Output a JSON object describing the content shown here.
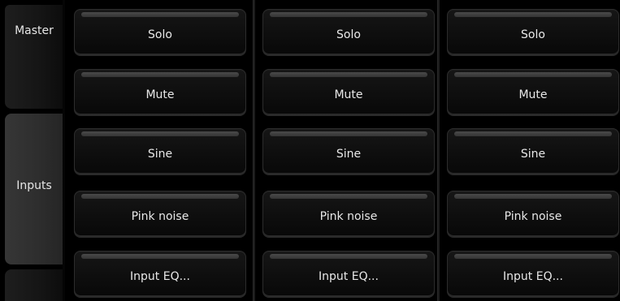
{
  "tabs": [
    {
      "id": "master",
      "label": "Master",
      "selected": false
    },
    {
      "id": "inputs",
      "label": "Inputs",
      "selected": true
    }
  ],
  "channels": [
    {
      "buttons": [
        "Solo",
        "Mute",
        "Sine",
        "Pink noise",
        "Input EQ..."
      ]
    },
    {
      "buttons": [
        "Solo",
        "Mute",
        "Sine",
        "Pink noise",
        "Input EQ..."
      ]
    },
    {
      "buttons": [
        "Solo",
        "Mute",
        "Sine",
        "Pink noise",
        "Input EQ..."
      ]
    }
  ]
}
